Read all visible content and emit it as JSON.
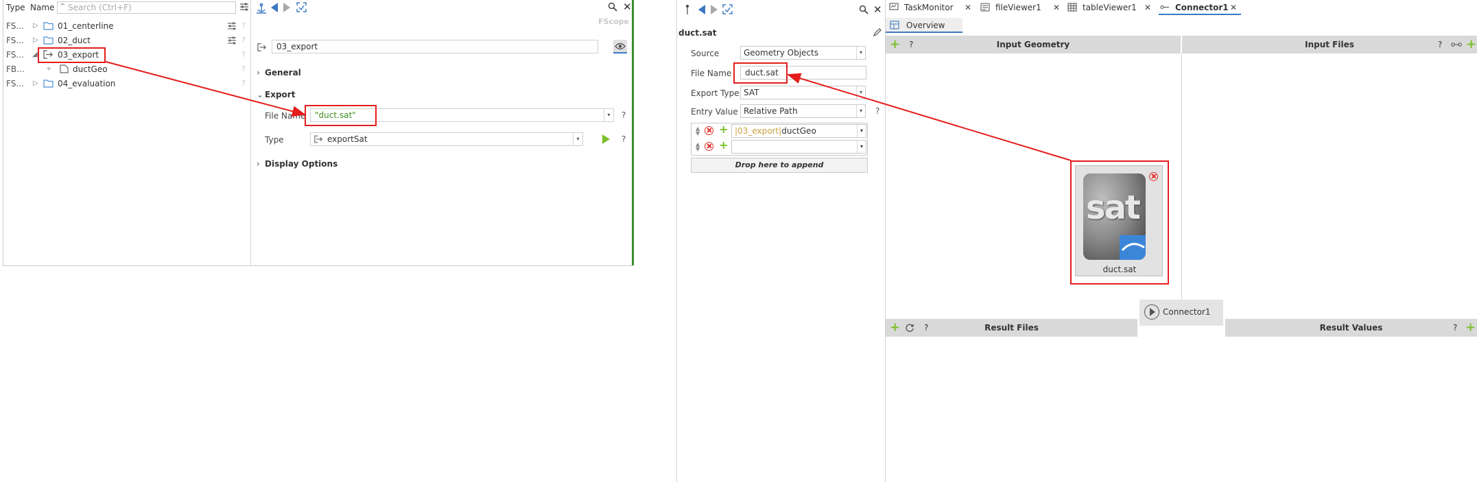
{
  "tree": {
    "header": {
      "type_label": "Type",
      "name_label": "Name",
      "search_placeholder": "Search (Ctrl+F)"
    },
    "rows": [
      {
        "type": "FS...",
        "label": "01_centerline",
        "icon": "folder-icon"
      },
      {
        "type": "FS...",
        "label": "02_duct",
        "icon": "folder-icon"
      },
      {
        "type": "FS...",
        "label": "03_export",
        "icon": "export-icon"
      },
      {
        "type": "FB...",
        "label": "ductGeo",
        "icon": "file-icon"
      },
      {
        "type": "FS...",
        "label": "04_evaluation",
        "icon": "folder-icon"
      }
    ]
  },
  "props": {
    "scope_label": "FScope",
    "name_value": "03_export",
    "sections": {
      "general": "General",
      "export": "Export",
      "display": "Display Options"
    },
    "file_name_label": "File Name",
    "file_name_value": "\"duct.sat\"",
    "type_label": "Type",
    "type_value": "exportSat",
    "help": "?"
  },
  "mid": {
    "title": "duct.sat",
    "source_label": "Source",
    "source_value": "Geometry Objects",
    "file_name_label": "File Name",
    "file_name_value": "duct.sat",
    "export_type_label": "Export Type",
    "export_type_value": "SAT",
    "entry_value_label": "Entry Value",
    "entry_value_value": "Relative Path",
    "entry_path_prefix": "|03_export|",
    "entry_path_item": "ductGeo",
    "drop_label": "Drop here to append",
    "help": "?"
  },
  "tabs": [
    {
      "label": "TaskMonitor",
      "icon": "monitor-icon"
    },
    {
      "label": "fileViewer1",
      "icon": "file-viewer-icon"
    },
    {
      "label": "tableViewer1",
      "icon": "table-icon"
    },
    {
      "label": "Connector1",
      "icon": "connector-icon",
      "active": true
    }
  ],
  "overview_label": "Overview",
  "sections": {
    "input_geometry": "Input Geometry",
    "input_files": "Input Files",
    "result_files": "Result Files",
    "result_values": "Result Values"
  },
  "sat_card": {
    "thumb_text": "sat",
    "caption": "duct.sat"
  },
  "connector_label": "Connector1",
  "colors": {
    "accent": "#3a78c2",
    "green": "#7cbf2a",
    "annotation": "#e41c1c",
    "section_bg": "#d9d9d9"
  }
}
